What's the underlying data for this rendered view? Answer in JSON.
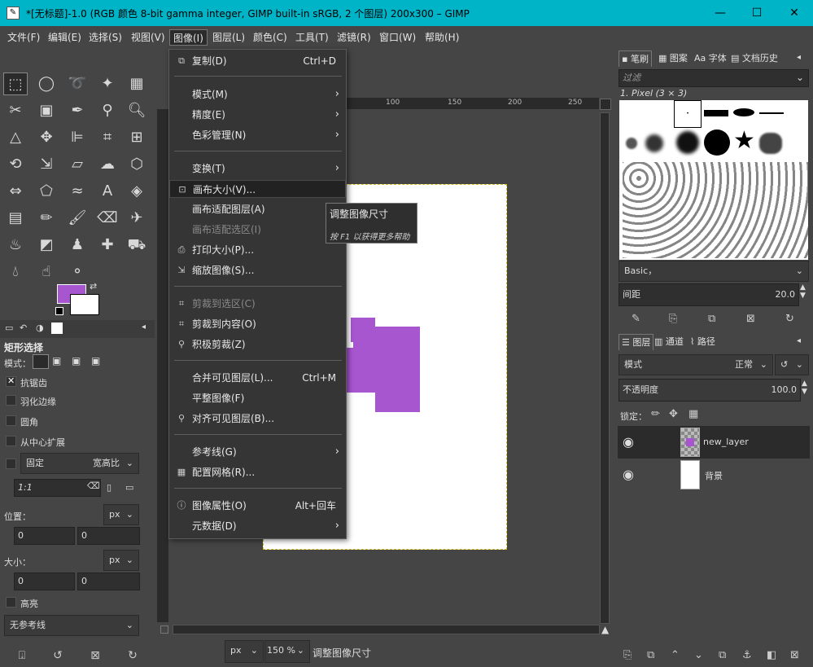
{
  "window": {
    "title": "*[无标题]-1.0 (RGB 颜色 8-bit gamma integer, GIMP built-in sRGB, 2 个图层) 200x300 – GIMP",
    "minimize_icon": "minimize-icon",
    "maximize_icon": "maximize-icon",
    "close_icon": "close-icon"
  },
  "menubar": {
    "items": [
      "文件(F)",
      "编辑(E)",
      "选择(S)",
      "视图(V)",
      "图像(I)",
      "图层(L)",
      "颜色(C)",
      "工具(T)",
      "滤镜(R)",
      "窗口(W)",
      "帮助(H)"
    ],
    "active": "图像(I)"
  },
  "image_menu": {
    "items": [
      {
        "label": "复制(D)",
        "shortcut": "Ctrl+D",
        "icon": "duplicate-icon"
      },
      {
        "label": "模式(M)",
        "submenu": true
      },
      {
        "label": "精度(E)",
        "submenu": true
      },
      {
        "label": "色彩管理(N)",
        "submenu": true
      },
      {
        "label": "变换(T)",
        "submenu": true
      },
      {
        "label": "画布大小(V)...",
        "icon": "canvas-size-icon",
        "highlighted": true
      },
      {
        "label": "画布适配图层(A)"
      },
      {
        "label": "画布适配选区(I)",
        "disabled": true
      },
      {
        "label": "打印大小(P)...",
        "icon": "print-icon"
      },
      {
        "label": "缩放图像(S)...",
        "icon": "scale-icon"
      },
      {
        "label": "剪裁到选区(C)",
        "icon": "crop-icon",
        "disabled": true
      },
      {
        "label": "剪裁到内容(O)",
        "icon": "crop-icon"
      },
      {
        "label": "积极剪裁(Z)",
        "icon": "zealous-crop-icon"
      },
      {
        "label": "合并可见图层(L)...",
        "shortcut": "Ctrl+M"
      },
      {
        "label": "平整图像(F)"
      },
      {
        "label": "对齐可见图层(B)...",
        "icon": "align-icon"
      },
      {
        "label": "参考线(G)",
        "submenu": true
      },
      {
        "label": "配置网格(R)...",
        "icon": "grid-icon"
      },
      {
        "label": "图像属性(O)",
        "shortcut": "Alt+回车",
        "icon": "info-icon"
      },
      {
        "label": "元数据(D)",
        "submenu": true
      }
    ]
  },
  "tooltip": {
    "title": "调整图像尺寸",
    "hint": "按 F1 以获得更多帮助"
  },
  "tool_options": {
    "title": "矩形选择",
    "mode_label": "模式：",
    "antialias": "抗锯齿",
    "feather": "羽化边缘",
    "rounded": "圆角",
    "expand_center": "从中心扩展",
    "fixed_label": "固定",
    "fixed_value": "宽高比",
    "ratio_value": "1:1",
    "position_label": "位置：",
    "size_label": "大小：",
    "unit": "px",
    "pos_x": "0",
    "pos_y": "0",
    "size_w": "0",
    "size_h": "0",
    "highlight": "高亮",
    "guides": "无参考线"
  },
  "ruler": {
    "marks": [
      "100",
      "150",
      "200",
      "250"
    ]
  },
  "statusbar": {
    "unit": "px",
    "zoom": "150 %",
    "message": "调整图像尺寸"
  },
  "brushes_panel": {
    "tabs": [
      "笔刷",
      "图案",
      "字体",
      "文档历史"
    ],
    "filter_placeholder": "过滤",
    "brush_name": "1. Pixel (3 × 3)",
    "preset": "Basic，",
    "spacing_label": "间距",
    "spacing_value": "20.0"
  },
  "layers_panel": {
    "tabs": [
      "图层",
      "通道",
      "路径"
    ],
    "mode_label": "模式",
    "mode_value": "正常",
    "opacity_label": "不透明度",
    "opacity_value": "100.0",
    "lock_label": "锁定：",
    "layers": [
      {
        "name": "new_layer",
        "selected": true
      },
      {
        "name": "背景",
        "selected": false
      }
    ]
  },
  "colors": {
    "foreground": "#a855d0",
    "background": "#ffffff",
    "titlebar": "#00b4c8"
  }
}
